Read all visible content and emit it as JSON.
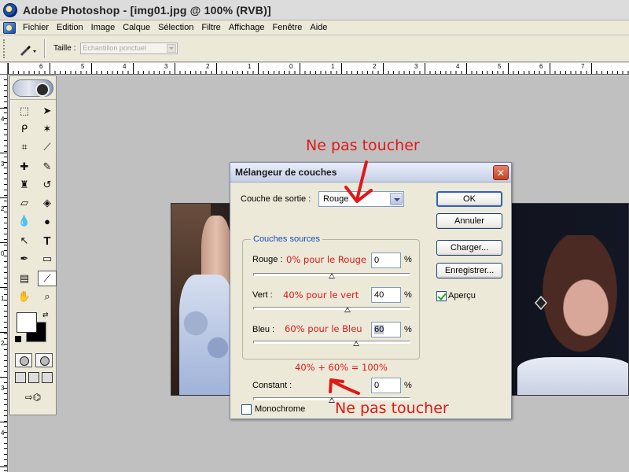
{
  "window": {
    "title": "Adobe Photoshop - [img01.jpg @ 100% (RVB)]"
  },
  "menu": {
    "items": [
      "Fichier",
      "Edition",
      "Image",
      "Calque",
      "Sélection",
      "Filtre",
      "Affichage",
      "Fenêtre",
      "Aide"
    ]
  },
  "options": {
    "size_label": "Taille :",
    "sample_value": "Echantillon ponctuel"
  },
  "rulers": {
    "h_labels": [
      "6",
      "5",
      "4",
      "3",
      "2",
      "1",
      "0",
      "1",
      "2",
      "3",
      "4",
      "5",
      "6",
      "7"
    ],
    "v_labels": [
      "4",
      "3",
      "2",
      "0",
      "1",
      "2",
      "3",
      "4",
      "5",
      "6",
      "7"
    ]
  },
  "dialog": {
    "title": "Mélangeur de couches",
    "output_label": "Couche de sortie :",
    "output_value": "Rouge",
    "sources_title": "Couches sources",
    "red_label": "Rouge :",
    "red_value": "0",
    "red_level": 0,
    "green_label": "Vert :",
    "green_value": "40",
    "green_level": 40,
    "blue_label": "Bleu :",
    "blue_value": "60",
    "blue_level": 60,
    "constant_label": "Constant :",
    "constant_value": "0",
    "constant_level": 0,
    "percent": "%",
    "buttons": {
      "ok": "OK",
      "cancel": "Annuler",
      "load": "Charger...",
      "save": "Enregistrer..."
    },
    "preview_label": "Aperçu",
    "preview_checked": true,
    "mono_label": "Monochrome",
    "mono_checked": false
  },
  "annotations": {
    "top": "Ne pas toucher",
    "bottom": "Ne pas toucher",
    "red_note": "0% pour le Rouge",
    "green_note": "40% pour le vert",
    "blue_note": "60% pour le Bleu",
    "sum_note": "40% + 60% = 100%",
    "color": "#e01818"
  },
  "tools": {
    "icons": [
      "marquee-icon",
      "move-icon",
      "lasso-icon",
      "magic-wand-icon",
      "crop-icon",
      "slice-icon",
      "healing-icon",
      "brush-icon",
      "stamp-icon",
      "history-brush-icon",
      "eraser-icon",
      "bucket-icon",
      "blur-icon",
      "burn-icon",
      "path-select-icon",
      "type-icon",
      "pen-icon",
      "shape-icon",
      "notes-icon",
      "eyedropper-icon",
      "hand-icon",
      "zoom-icon"
    ]
  }
}
